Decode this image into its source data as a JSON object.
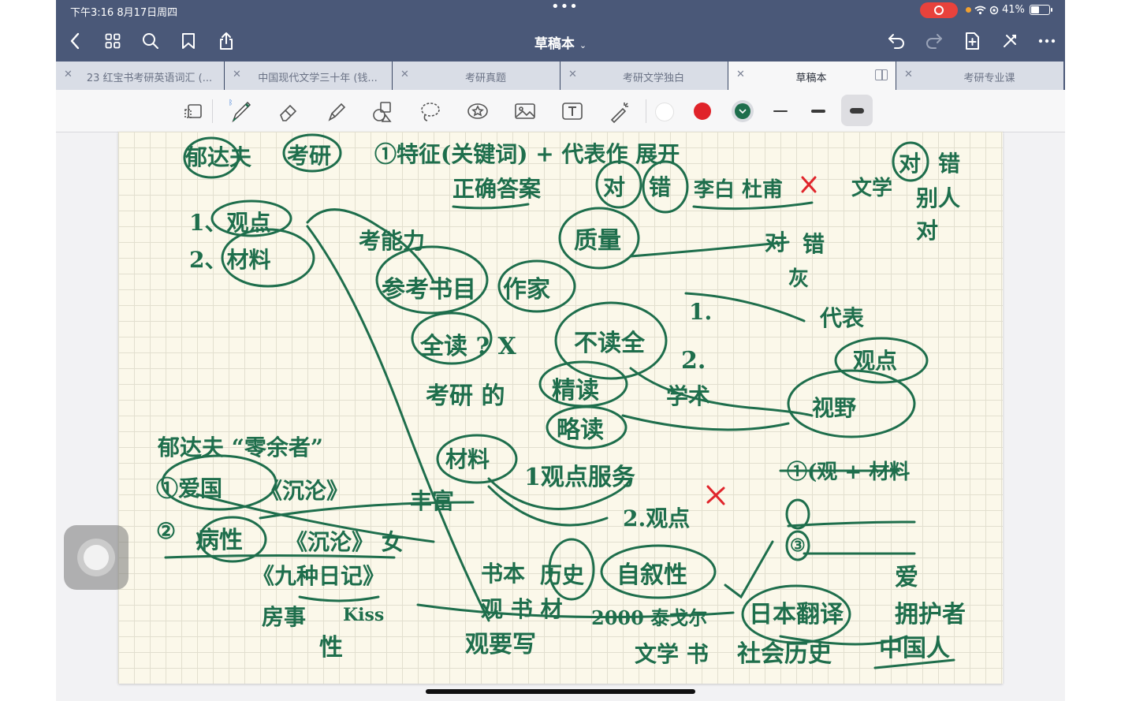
{
  "status_bar": {
    "time_date": "下午3:16  8月17日周四",
    "battery": "41%"
  },
  "nav": {
    "title": "草稿本",
    "icons": [
      "back-icon",
      "grid-icon",
      "search-icon",
      "bookmark-icon",
      "share-icon",
      "undo-icon",
      "redo-icon",
      "add-page-icon",
      "close-edit-icon",
      "more-icon"
    ]
  },
  "tabs": [
    {
      "label": "23 红宝书考研英语词汇 (..."
    },
    {
      "label": "中国现代文学三十年 (钱..."
    },
    {
      "label": "考研真题"
    },
    {
      "label": "考研文学独白"
    },
    {
      "label": "草稿本",
      "active": true
    },
    {
      "label": "考研专业课"
    }
  ],
  "toolbar": {
    "tools": [
      "lasso-page-icon",
      "pen-icon",
      "eraser-icon",
      "highlighter-icon",
      "shapes-icon",
      "lasso-icon",
      "sticker-icon",
      "image-icon",
      "text-icon",
      "laser-pointer-icon"
    ],
    "colors": {
      "white": "#ffffff",
      "red": "#e0232a",
      "green": "#1e6e4c"
    },
    "selected_color": "green",
    "selected_stroke": "thick"
  },
  "notes": {
    "ink_color": "#1e6e4c",
    "mark_color": "#e0252b",
    "words": {
      "w1": "郁达夫",
      "w2": "考研",
      "w3": "①特征(关键词) + 代表作 展开",
      "w4": "正确答案",
      "w5": "对",
      "w6": "错",
      "w7": "李白 杜甫",
      "w8": "文学",
      "w9": "对",
      "w10": "错",
      "w11": "别人",
      "w12": "对",
      "w13": "1、观点",
      "w14": "2、材料",
      "w15": "考能力",
      "w16": "质量",
      "w17": "对",
      "w18": "错",
      "w19": "灰",
      "w20": "参考书目",
      "w21": "作家",
      "w22": "1.",
      "w23": "2.",
      "w24": "代表",
      "w25": "全读 ? X",
      "w26": "不读全",
      "w27": "观点",
      "w28": "考研 的",
      "w29": "精读",
      "w30": "学术",
      "w31": "视野",
      "w32": "略读",
      "w33": "郁达夫 “零余者”",
      "w34": "材料",
      "w35": "①爱国",
      "w36": "《沉沦》",
      "w37": "丰富",
      "w38": "1观点服务",
      "w39": "①(观 + 材料",
      "w40": "②",
      "w41": "病性",
      "w42": "《沉沦》 女",
      "w43": "2.观点",
      "w44": "③",
      "w45": "《九种日记》",
      "w46": "书本",
      "w47": "历史",
      "w48": "自叙性",
      "w49": "爱",
      "w50": "房事",
      "w51": "Kiss",
      "w52": "观 书 材",
      "w53": "日本翻译",
      "w54": "拥护者",
      "w55": "性",
      "w56": "观要写",
      "w57": "2000 泰戈尔",
      "w58": "文学 书",
      "w59": "社会历史",
      "w60": "中国人"
    }
  }
}
